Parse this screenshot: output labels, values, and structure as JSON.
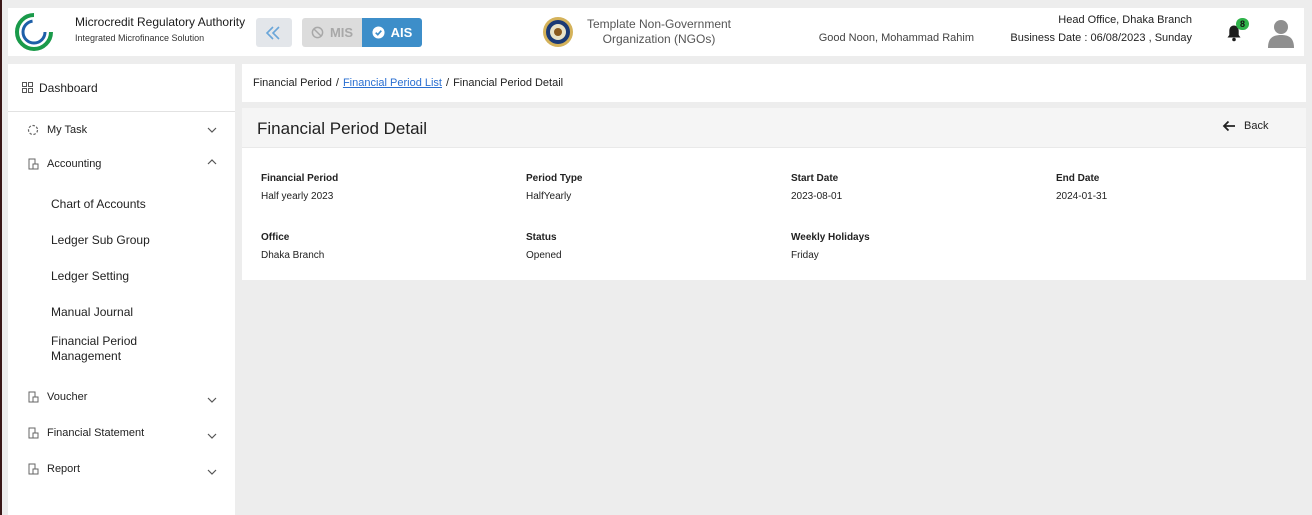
{
  "header": {
    "logo_text": "Microcredit Regulatory Authority",
    "brand_title": "Microcredit Regulatory Authority",
    "brand_subtitle": "Integrated Microfinance Solution",
    "mis_label": "MIS",
    "ais_label": "AIS",
    "org_name_line1": "Template Non-Government",
    "org_name_line2": "Organization (NGOs)",
    "greeting": "Good Noon, Mohammad Rahim",
    "office": "Head Office, Dhaka Branch",
    "business_date": "Business Date : 06/08/2023 , Sunday",
    "notification_count": "8"
  },
  "sidebar": {
    "dashboard": "Dashboard",
    "items": [
      {
        "label": "My Task",
        "expanded": false
      },
      {
        "label": "Accounting",
        "expanded": true
      },
      {
        "label": "Voucher",
        "expanded": false
      },
      {
        "label": "Financial Statement",
        "expanded": false
      },
      {
        "label": "Report",
        "expanded": false
      }
    ],
    "accounting_sub": [
      "Chart of Accounts",
      "Ledger Sub Group",
      "Ledger Setting",
      "Manual Journal",
      "Financial Period Management"
    ]
  },
  "breadcrumb": {
    "root": "Financial Period",
    "link": "Financial Period List",
    "current": "Financial Period Detail",
    "separator": "/"
  },
  "detail": {
    "title": "Financial Period Detail",
    "back_label": "Back",
    "fields": [
      {
        "label": "Financial Period",
        "value": "Half yearly 2023"
      },
      {
        "label": "Period Type",
        "value": "HalfYearly"
      },
      {
        "label": "Start Date",
        "value": "2023-08-01"
      },
      {
        "label": "End Date",
        "value": "2024-01-31"
      },
      {
        "label": "Office",
        "value": "Dhaka Branch"
      },
      {
        "label": "Status",
        "value": "Opened"
      },
      {
        "label": "Weekly Holidays",
        "value": "Friday"
      }
    ]
  },
  "colors": {
    "accent": "#3d8ec9",
    "link": "#2a6fd1",
    "badge": "#2fb34a",
    "logo_green": "#1a9a4a",
    "logo_blue": "#1d5fa8"
  }
}
